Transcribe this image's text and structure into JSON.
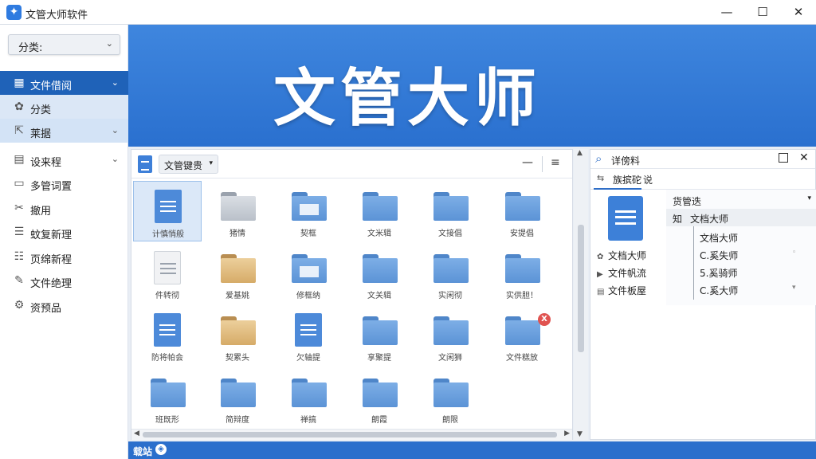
{
  "window": {
    "title": "文管大师软件",
    "app_icon_glyph": "✦",
    "minimize_glyph": "—",
    "maximize_glyph": "☐",
    "close_glyph": "✕"
  },
  "sidebar": {
    "category_dropdown": {
      "label": "分类:",
      "chevron": "⌄"
    },
    "items": [
      {
        "label": "文件借阅",
        "icon": "grid-icon",
        "glyph": "▦",
        "arrow": "⌄",
        "state": "active"
      },
      {
        "label": "分类",
        "icon": "gear-icon",
        "glyph": "✿",
        "arrow": "",
        "state": "selected"
      },
      {
        "label": "莱据",
        "icon": "export-icon",
        "glyph": "⇱",
        "arrow": "⌄",
        "state": "selected2"
      },
      {
        "label": "设来程",
        "icon": "document-icon",
        "glyph": "▤",
        "arrow": "⌄",
        "state": ""
      },
      {
        "label": "多管词置",
        "icon": "folder-icon",
        "glyph": "▭",
        "arrow": "",
        "state": ""
      },
      {
        "label": "撤用",
        "icon": "tools-icon",
        "glyph": "✂",
        "arrow": "",
        "state": ""
      },
      {
        "label": "蚊复新理",
        "icon": "database-icon",
        "glyph": "☰",
        "arrow": "",
        "state": ""
      },
      {
        "label": "页绵新程",
        "icon": "list-icon",
        "glyph": "☷",
        "arrow": "",
        "state": ""
      },
      {
        "label": "文件绝理",
        "icon": "edit-icon",
        "glyph": "✎",
        "arrow": "",
        "state": ""
      },
      {
        "label": "资预品",
        "icon": "settings-icon",
        "glyph": "⚙",
        "arrow": "",
        "state": ""
      }
    ]
  },
  "banner": {
    "title": "文管大师"
  },
  "file_pane": {
    "view_dropdown": {
      "label": "文管键贵",
      "chevron": "▾"
    },
    "minimize_glyph": "—",
    "menu_glyph": "≡",
    "tiles": [
      {
        "label": "计慎悄般",
        "kind": "doc-blue",
        "selected": true
      },
      {
        "label": "猪情",
        "kind": "folder-grey"
      },
      {
        "label": "契框",
        "kind": "folder-doc"
      },
      {
        "label": "文米辑",
        "kind": "folder-blue"
      },
      {
        "label": "文接倡",
        "kind": "folder-blue"
      },
      {
        "label": "安提倡",
        "kind": "folder-blue"
      },
      {
        "label": "件转彻",
        "kind": "doc-white"
      },
      {
        "label": "爱基姚",
        "kind": "folder-tan"
      },
      {
        "label": "修框纳",
        "kind": "folder-doc"
      },
      {
        "label": "文关辑",
        "kind": "folder-blue"
      },
      {
        "label": "实闲彻",
        "kind": "folder-blue"
      },
      {
        "label": "实供胆！",
        "kind": "folder-blue"
      },
      {
        "label": "防将帕会",
        "kind": "doc-blue"
      },
      {
        "label": "契累头",
        "kind": "folder-tan"
      },
      {
        "label": "欠轴提",
        "kind": "doc-blue"
      },
      {
        "label": "享聚提",
        "kind": "folder-blue"
      },
      {
        "label": "文闲狮",
        "kind": "folder-blue"
      },
      {
        "label": "文件糕放",
        "kind": "folder-blue",
        "badge": "X"
      },
      {
        "label": "班既形",
        "kind": "folder-blue"
      },
      {
        "label": "简辩度",
        "kind": "folder-blue"
      },
      {
        "label": "禅搞",
        "kind": "folder-blue"
      },
      {
        "label": "朗霞",
        "kind": "folder-blue"
      },
      {
        "label": "朗限",
        "kind": "folder-blue"
      }
    ]
  },
  "detail": {
    "title": "详傍料",
    "tab1_label": "族摈砣",
    "tab1_icon": "⇆",
    "tab2_label": "说",
    "props": [
      {
        "label": "文档大师",
        "glyph": "✿"
      },
      {
        "label": "文件帆流",
        "glyph": "▶"
      },
      {
        "label": "文件板屋",
        "glyph": "▤"
      }
    ],
    "tree": {
      "header": "货管迭",
      "chevron": "▾",
      "root_prefix": "知",
      "root_label": "文档大师",
      "children": [
        {
          "label": "文档大师",
          "dot": ""
        },
        {
          "label": "C.奚失师",
          "dot": "◦"
        },
        {
          "label": "5.奚骑师",
          "dot": ""
        },
        {
          "label": "C.奚大师",
          "dot": "▾"
        }
      ]
    }
  },
  "statusbar": {
    "label": "载站",
    "icon_glyph": "◈"
  }
}
